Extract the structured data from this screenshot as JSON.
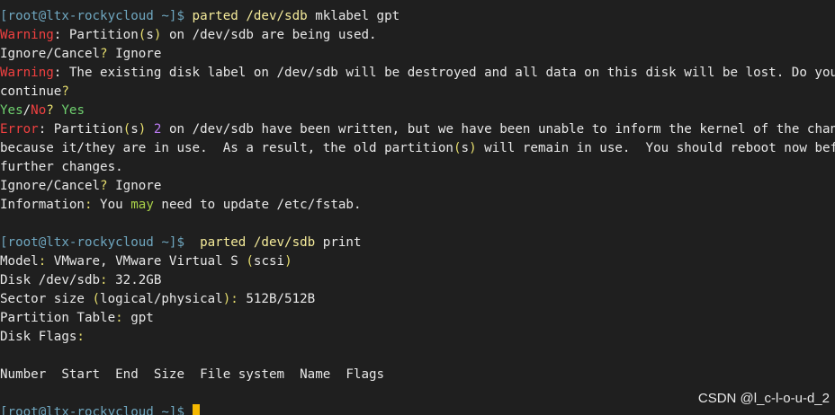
{
  "colors": {
    "background": "#1f1f1f",
    "default_text": "#e8e8e8",
    "prompt": "#6fa7c0",
    "command": "#f5eb9a",
    "warning": "#f04040",
    "punct": "#e7de6e",
    "number": "#ba7af0",
    "yes": "#6fd06f",
    "may": "#a8d048",
    "cursor": "#f5b800"
  },
  "lines": [
    [
      {
        "t": "[root@ltx-rockycloud ~]$",
        "c": "prompt"
      },
      {
        "t": " ",
        "c": "default_text"
      },
      {
        "t": "parted /dev/sdb",
        "c": "command"
      },
      {
        "t": " mklabel gpt",
        "c": "default_text"
      }
    ],
    [
      {
        "t": "Warning",
        "c": "warning"
      },
      {
        "t": ": Partition",
        "c": "default_text"
      },
      {
        "t": "(",
        "c": "punct"
      },
      {
        "t": "s",
        "c": "default_text"
      },
      {
        "t": ")",
        "c": "punct"
      },
      {
        "t": " on /dev/sdb are being used.",
        "c": "default_text"
      }
    ],
    [
      {
        "t": "Ignore/Cancel",
        "c": "default_text"
      },
      {
        "t": "?",
        "c": "punct"
      },
      {
        "t": " Ignore",
        "c": "default_text"
      }
    ],
    [
      {
        "t": "Warning",
        "c": "warning"
      },
      {
        "t": ": The existing disk label on /dev/sdb will be destroyed and all data on this disk will be lost. Do you want to",
        "c": "default_text"
      }
    ],
    [
      {
        "t": "continue",
        "c": "default_text"
      },
      {
        "t": "?",
        "c": "punct"
      }
    ],
    [
      {
        "t": "Yes",
        "c": "yes"
      },
      {
        "t": "/",
        "c": "default_text"
      },
      {
        "t": "No",
        "c": "warning"
      },
      {
        "t": "?",
        "c": "punct"
      },
      {
        "t": " ",
        "c": "default_text"
      },
      {
        "t": "Yes",
        "c": "yes"
      }
    ],
    [
      {
        "t": "Error",
        "c": "warning"
      },
      {
        "t": ": Partition",
        "c": "default_text"
      },
      {
        "t": "(",
        "c": "punct"
      },
      {
        "t": "s",
        "c": "default_text"
      },
      {
        "t": ")",
        "c": "punct"
      },
      {
        "t": " ",
        "c": "default_text"
      },
      {
        "t": "2",
        "c": "number"
      },
      {
        "t": " on /dev/sdb have been written, but we have been unable to inform the kernel of the change, probably",
        "c": "default_text"
      }
    ],
    [
      {
        "t": "because it/they are in use.  As a result, the old partition",
        "c": "default_text"
      },
      {
        "t": "(",
        "c": "punct"
      },
      {
        "t": "s",
        "c": "default_text"
      },
      {
        "t": ")",
        "c": "punct"
      },
      {
        "t": " will remain in use.  You should reboot now before making",
        "c": "default_text"
      }
    ],
    [
      {
        "t": "further changes.",
        "c": "default_text"
      }
    ],
    [
      {
        "t": "Ignore/Cancel",
        "c": "default_text"
      },
      {
        "t": "?",
        "c": "punct"
      },
      {
        "t": " Ignore",
        "c": "default_text"
      }
    ],
    [
      {
        "t": "Information",
        "c": "default_text"
      },
      {
        "t": ":",
        "c": "punct"
      },
      {
        "t": " You ",
        "c": "default_text"
      },
      {
        "t": "may",
        "c": "may"
      },
      {
        "t": " need to update /etc/fstab.",
        "c": "default_text"
      }
    ],
    [],
    [
      {
        "t": "[root@ltx-rockycloud ~]$",
        "c": "prompt"
      },
      {
        "t": "  ",
        "c": "default_text"
      },
      {
        "t": "parted",
        "c": "command"
      },
      {
        "t": " ",
        "c": "default_text"
      },
      {
        "t": "/dev/sdb",
        "c": "command"
      },
      {
        "t": " print",
        "c": "default_text"
      }
    ],
    [
      {
        "t": "Model",
        "c": "default_text"
      },
      {
        "t": ":",
        "c": "punct"
      },
      {
        "t": " VMware, VMware Virtual S ",
        "c": "default_text"
      },
      {
        "t": "(",
        "c": "punct"
      },
      {
        "t": "scsi",
        "c": "default_text"
      },
      {
        "t": ")",
        "c": "punct"
      }
    ],
    [
      {
        "t": "Disk /dev/sdb",
        "c": "default_text"
      },
      {
        "t": ":",
        "c": "punct"
      },
      {
        "t": " 32.2GB",
        "c": "default_text"
      }
    ],
    [
      {
        "t": "Sector size ",
        "c": "default_text"
      },
      {
        "t": "(",
        "c": "punct"
      },
      {
        "t": "logical/physical",
        "c": "default_text"
      },
      {
        "t": ")",
        "c": "punct"
      },
      {
        "t": ":",
        "c": "punct"
      },
      {
        "t": " 512B/512B",
        "c": "default_text"
      }
    ],
    [
      {
        "t": "Partition Table",
        "c": "default_text"
      },
      {
        "t": ":",
        "c": "punct"
      },
      {
        "t": " gpt",
        "c": "default_text"
      }
    ],
    [
      {
        "t": "Disk Flags",
        "c": "default_text"
      },
      {
        "t": ":",
        "c": "punct"
      }
    ],
    [],
    [
      {
        "t": "Number  Start  End  Size  File system  Name  Flags",
        "c": "default_text"
      }
    ],
    [],
    [
      {
        "t": "[root@ltx-rockycloud ~]$",
        "c": "prompt"
      },
      {
        "t": " ",
        "c": "default_text"
      }
    ]
  ],
  "watermark": "CSDN @l_c-l-o-u-d_2"
}
